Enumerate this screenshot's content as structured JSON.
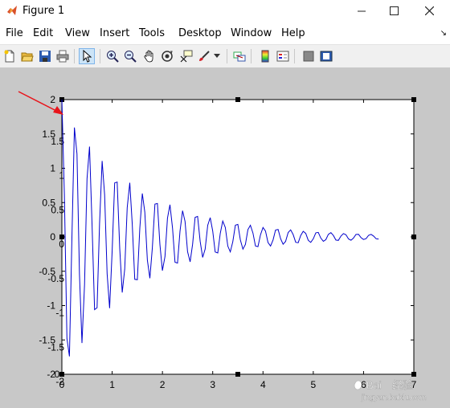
{
  "window": {
    "title": "Figure 1",
    "minimize": "—",
    "maximize": "☐",
    "close": "✕"
  },
  "menu": [
    "File",
    "Edit",
    "View",
    "Insert",
    "Tools",
    "Desktop",
    "Window",
    "Help"
  ],
  "menu_dock_arrow": "↘",
  "toolbar": {
    "icons": [
      "new-figure-icon",
      "open-file-icon",
      "save-icon",
      "print-icon",
      "select-arrow-icon",
      "zoom-in-icon",
      "zoom-out-icon",
      "pan-hand-icon",
      "rotate-3d-icon",
      "data-cursor-icon",
      "brush-icon",
      "brush-dropdown-icon",
      "link-plot-icon",
      "colorbar-icon",
      "legend-icon",
      "hide-plot-tools-icon",
      "show-plot-tools-icon"
    ],
    "selected": "select-arrow-icon"
  },
  "colors": {
    "line": "#0000cc",
    "annotation_arrow": "#e8141b",
    "canvas_bg": "#c8c8c8"
  },
  "chart_data": {
    "type": "line",
    "function_description_visible": false,
    "xlim": [
      0,
      7
    ],
    "ylim": [
      -2,
      2
    ],
    "x_ticks": [
      "0",
      "1",
      "2",
      "3",
      "4",
      "5",
      "6",
      "7"
    ],
    "y_ticks": [
      "2",
      "1.5",
      "1",
      "0.5",
      "0",
      "-0.5",
      "-1",
      "-1.5",
      "-2"
    ],
    "y_ticks_ghost": [
      "1.5",
      "1",
      "0.5",
      "0",
      "-0.5",
      "-1",
      "-1.5",
      "-2"
    ],
    "x_tick_ghost": "0",
    "series": [
      {
        "x": [
          0,
          0.05,
          0.1,
          0.15,
          0.2,
          0.25,
          0.3,
          0.35,
          0.4,
          0.45,
          0.5,
          0.55,
          0.6,
          0.65,
          0.7,
          0.75,
          0.8,
          0.85,
          0.9,
          0.95,
          1.0,
          1.05,
          1.1,
          1.15,
          1.2,
          1.25,
          1.3,
          1.35,
          1.4,
          1.45,
          1.5,
          1.55,
          1.6,
          1.65,
          1.7,
          1.75,
          1.8,
          1.85,
          1.9,
          1.95,
          2.0,
          2.05,
          2.1,
          2.15,
          2.2,
          2.25,
          2.3,
          2.35,
          2.4,
          2.45,
          2.5,
          2.55,
          2.6,
          2.65,
          2.7,
          2.75,
          2.8,
          2.85,
          2.9,
          2.95,
          3.0,
          3.05,
          3.1,
          3.15,
          3.2,
          3.25,
          3.3,
          3.35,
          3.4,
          3.45,
          3.5,
          3.55,
          3.6,
          3.65,
          3.7,
          3.75,
          3.8,
          3.85,
          3.9,
          3.95,
          4.0,
          4.05,
          4.1,
          4.15,
          4.2,
          4.25,
          4.3,
          4.35,
          4.4,
          4.45,
          4.5,
          4.55,
          4.6,
          4.65,
          4.7,
          4.75,
          4.8,
          4.85,
          4.9,
          4.95,
          5.0,
          5.05,
          5.1,
          5.15,
          5.2,
          5.25,
          5.3,
          5.35,
          5.4,
          5.45,
          5.5,
          5.55,
          5.6,
          5.65,
          5.7,
          5.75,
          5.8,
          5.85,
          5.9,
          5.95,
          6.0,
          6.05,
          6.1,
          6.15,
          6.2,
          6.25,
          6.3
        ],
        "y": [
          2.0,
          0.624,
          -1.479,
          -1.739,
          -0.009,
          1.593,
          1.209,
          -0.545,
          -1.545,
          -0.697,
          0.848,
          1.316,
          0.199,
          -1.058,
          -1.03,
          0.197,
          1.106,
          0.612,
          -0.533,
          -1.037,
          -0.197,
          0.787,
          0.799,
          -0.167,
          -0.809,
          -0.469,
          0.426,
          0.79,
          0.183,
          -0.617,
          -0.623,
          0.129,
          0.633,
          0.363,
          -0.338,
          -0.601,
          -0.155,
          0.478,
          0.486,
          -0.109,
          -0.49,
          -0.286,
          0.272,
          0.469,
          0.13,
          -0.368,
          -0.381,
          0.083,
          0.383,
          0.225,
          -0.214,
          -0.362,
          -0.107,
          0.285,
          0.299,
          -0.066,
          -0.298,
          -0.178,
          0.17,
          0.281,
          0.087,
          -0.22,
          -0.233,
          0.052,
          0.231,
          0.138,
          -0.133,
          -0.218,
          -0.07,
          0.171,
          0.182,
          -0.042,
          -0.178,
          -0.109,
          0.106,
          0.17,
          0.056,
          -0.131,
          -0.141,
          0.033,
          0.138,
          0.085,
          -0.081,
          -0.132,
          -0.044,
          0.101,
          0.109,
          -0.026,
          -0.106,
          -0.066,
          0.064,
          0.103,
          0.035,
          -0.078,
          -0.084,
          0.021,
          0.082,
          0.052,
          -0.049,
          -0.08,
          -0.027,
          0.06,
          0.065,
          -0.016,
          -0.063,
          -0.04,
          0.038,
          0.062,
          0.021,
          -0.046,
          -0.05,
          0.013,
          0.049,
          0.031,
          -0.029,
          -0.048,
          -0.016,
          0.036,
          0.038,
          -0.01,
          -0.038,
          -0.024,
          0.023,
          0.037,
          0.013,
          -0.027,
          -0.03
        ]
      }
    ],
    "grid": false
  },
  "watermark": {
    "brand": "Bai",
    "suffix": "经验",
    "url": "jingyan.baidu.com"
  }
}
